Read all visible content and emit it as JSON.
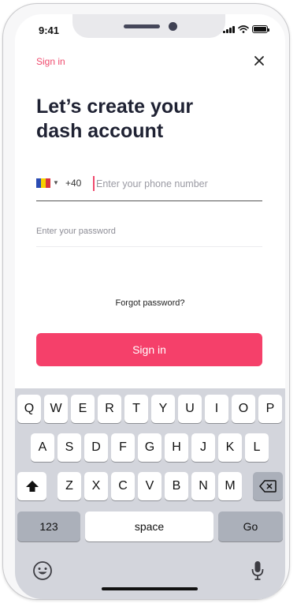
{
  "status_bar": {
    "time": "9:41",
    "icons": [
      "cellular-signal-icon",
      "wifi-icon",
      "battery-icon"
    ]
  },
  "header": {
    "link_label": "Sign in",
    "close_icon": "close-icon"
  },
  "title": "Let’s create your\ndash account",
  "phone": {
    "country_flag": "romania-flag-icon",
    "flag_colors": [
      "#2b4cb3",
      "#f6d100",
      "#d9363e"
    ],
    "dial_code": "+40",
    "placeholder": "Enter your phone number",
    "value": ""
  },
  "password": {
    "placeholder": "Enter your password",
    "value": ""
  },
  "forgot_label": "Forgot password?",
  "signin_button_label": "Sign in",
  "keyboard": {
    "row1": [
      "Q",
      "W",
      "E",
      "R",
      "T",
      "Y",
      "U",
      "I",
      "O",
      "P"
    ],
    "row2": [
      "A",
      "S",
      "D",
      "F",
      "G",
      "H",
      "J",
      "K",
      "L"
    ],
    "row3": [
      "Z",
      "X",
      "C",
      "V",
      "B",
      "N",
      "M"
    ],
    "numbers_label": "123",
    "space_label": "space",
    "go_label": "Go",
    "shift_icon": "shift-icon",
    "backspace_icon": "backspace-icon",
    "emoji_icon": "emoji-icon",
    "mic_icon": "microphone-icon"
  },
  "colors": {
    "accent": "#f5406a",
    "keyboard_bg": "#d3d5dc"
  }
}
